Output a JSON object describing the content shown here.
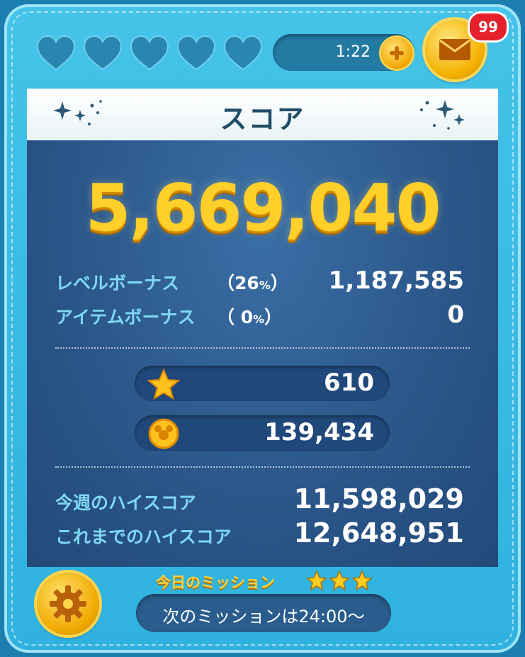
{
  "header": {
    "hearts": [
      "heart",
      "heart",
      "heart",
      "heart",
      "heart"
    ],
    "timer": "1:22",
    "mail_badge": "99"
  },
  "title": "スコア",
  "score": "5,669,040",
  "bonuses": [
    {
      "label": "レベルボーナス",
      "pct_open": "（",
      "pct_value": "26",
      "pct_unit": "%",
      "pct_close": "）",
      "value": "1,187,585"
    },
    {
      "label": "アイテムボーナス",
      "pct_open": "（",
      "pct_value": "0",
      "pct_unit": "%",
      "pct_close": "）",
      "value": "0"
    }
  ],
  "rewards": [
    {
      "icon": "star-icon",
      "value": "610"
    },
    {
      "icon": "coin-icon",
      "value": "139,434"
    }
  ],
  "high_scores": [
    {
      "label": "今週のハイスコア",
      "value": "11,598,029"
    },
    {
      "label": "これまでのハイスコア",
      "value": "12,648,951"
    }
  ],
  "mission": {
    "title": "今日のミッション",
    "stars": 3,
    "next_text": "次のミッションは24:00〜"
  },
  "colors": {
    "frame": "#2fb2df",
    "panel": "#2a5588",
    "score_gold": "#ffcf2a",
    "label_blue": "#7fd8f2",
    "badge_red": "#e4202a"
  }
}
